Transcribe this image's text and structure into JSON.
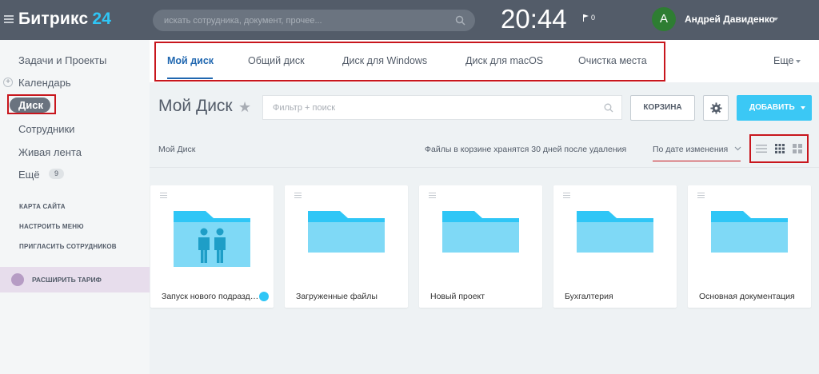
{
  "header": {
    "logo_text": "Битрикс",
    "logo_number": "24",
    "search_placeholder": "искать сотрудника, документ, прочее...",
    "clock": "20:44",
    "notifications_count": "0",
    "user_initial": "А",
    "user_name": "Андрей Давиденко"
  },
  "sidebar": {
    "items": [
      {
        "label": "Задачи и Проекты"
      },
      {
        "label": "Календарь"
      },
      {
        "label": "Диск"
      },
      {
        "label": "Сотрудники"
      },
      {
        "label": "Живая лента"
      },
      {
        "label": "Ещё"
      }
    ],
    "more_badge": "9",
    "links": [
      "КАРТА САЙТА",
      "НАСТРОИТЬ МЕНЮ",
      "ПРИГЛАСИТЬ СОТРУДНИКОВ"
    ],
    "upgrade_label": "РАСШИРИТЬ ТАРИФ"
  },
  "tabs": [
    {
      "label": "Мой диск",
      "active": true
    },
    {
      "label": "Общий диск"
    },
    {
      "label": "Диск для Windows"
    },
    {
      "label": "Диск для macOS"
    },
    {
      "label": "Очистка места"
    }
  ],
  "tabs_more": "Еще",
  "toolbar": {
    "title": "Мой Диск",
    "filter_placeholder": "Фильтр + поиск",
    "trash_label": "КОРЗИНА",
    "add_label": "ДОБАВИТЬ"
  },
  "breadcrumb": "Мой Диск",
  "trash_note": "Файлы в корзине хранятся 30 дней после удаления",
  "sort_label": "По дате изменения",
  "folders": [
    {
      "name": "Запуск нового подразделения",
      "shared": true,
      "icon": "folder-people-icon"
    },
    {
      "name": "Загруженные файлы",
      "icon": "folder-icon"
    },
    {
      "name": "Новый проект",
      "icon": "folder-icon"
    },
    {
      "name": "Бухгалтерия",
      "icon": "folder-icon"
    },
    {
      "name": "Основная документация",
      "icon": "folder-icon"
    }
  ],
  "colors": {
    "header_bg": "#535c69",
    "accent_blue": "#3bc8f5",
    "active_tab": "#2067b0",
    "folder_blue": "#7fd9f6",
    "annotation_red": "#c8161d"
  }
}
